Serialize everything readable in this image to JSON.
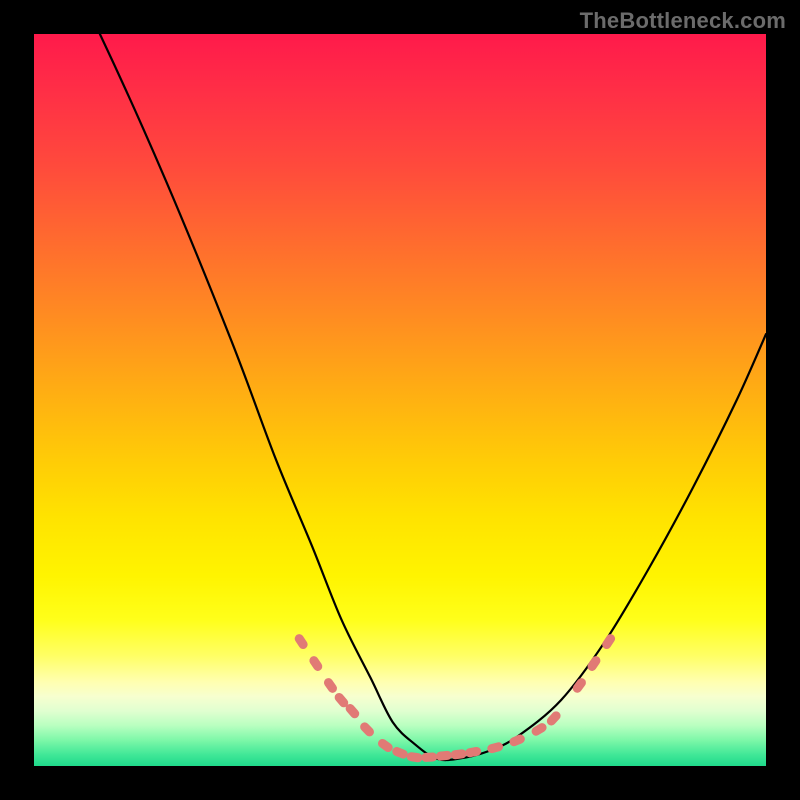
{
  "watermark": "TheBottleneck.com",
  "colors": {
    "page_bg": "#000000",
    "curve": "#000000",
    "highlight": "#e17a75",
    "gradient_stops": [
      {
        "offset": 0.0,
        "color": "#ff1a4b"
      },
      {
        "offset": 0.08,
        "color": "#ff2f46"
      },
      {
        "offset": 0.18,
        "color": "#ff4a3c"
      },
      {
        "offset": 0.28,
        "color": "#ff6a2f"
      },
      {
        "offset": 0.38,
        "color": "#ff8a22"
      },
      {
        "offset": 0.48,
        "color": "#ffab14"
      },
      {
        "offset": 0.58,
        "color": "#ffcb07"
      },
      {
        "offset": 0.66,
        "color": "#ffe300"
      },
      {
        "offset": 0.74,
        "color": "#fff400"
      },
      {
        "offset": 0.8,
        "color": "#ffff1a"
      },
      {
        "offset": 0.85,
        "color": "#ffff66"
      },
      {
        "offset": 0.885,
        "color": "#ffffb0"
      },
      {
        "offset": 0.905,
        "color": "#f7ffcf"
      },
      {
        "offset": 0.925,
        "color": "#e0ffd0"
      },
      {
        "offset": 0.945,
        "color": "#b8ffc0"
      },
      {
        "offset": 0.965,
        "color": "#7cf7a8"
      },
      {
        "offset": 0.985,
        "color": "#3fe797"
      },
      {
        "offset": 1.0,
        "color": "#1fd98b"
      }
    ]
  },
  "chart_data": {
    "type": "line",
    "title": "",
    "xlabel": "",
    "ylabel": "",
    "xlim": [
      0,
      100
    ],
    "ylim": [
      0,
      100
    ],
    "series": [
      {
        "name": "curve",
        "x": [
          0,
          9,
          18,
          27,
          33,
          38,
          42,
          46,
          49,
          52,
          55,
          58,
          62,
          66,
          72,
          78,
          84,
          90,
          96,
          100
        ],
        "y": [
          118,
          100,
          80,
          58,
          42,
          30,
          20,
          12,
          6,
          3,
          1,
          1,
          2,
          4,
          9,
          17,
          27,
          38,
          50,
          59
        ]
      }
    ],
    "highlighted_points": [
      {
        "x": 36.5,
        "y": 17
      },
      {
        "x": 38.5,
        "y": 14
      },
      {
        "x": 40.5,
        "y": 11
      },
      {
        "x": 42.0,
        "y": 9
      },
      {
        "x": 43.5,
        "y": 7.5
      },
      {
        "x": 45.5,
        "y": 5
      },
      {
        "x": 48.0,
        "y": 2.8
      },
      {
        "x": 50.0,
        "y": 1.8
      },
      {
        "x": 52.0,
        "y": 1.2
      },
      {
        "x": 54.0,
        "y": 1.2
      },
      {
        "x": 56.0,
        "y": 1.4
      },
      {
        "x": 58.0,
        "y": 1.6
      },
      {
        "x": 60.0,
        "y": 1.9
      },
      {
        "x": 63.0,
        "y": 2.5
      },
      {
        "x": 66.0,
        "y": 3.5
      },
      {
        "x": 69.0,
        "y": 5.0
      },
      {
        "x": 71.0,
        "y": 6.5
      },
      {
        "x": 74.5,
        "y": 11
      },
      {
        "x": 76.5,
        "y": 14
      },
      {
        "x": 78.5,
        "y": 17
      }
    ]
  }
}
